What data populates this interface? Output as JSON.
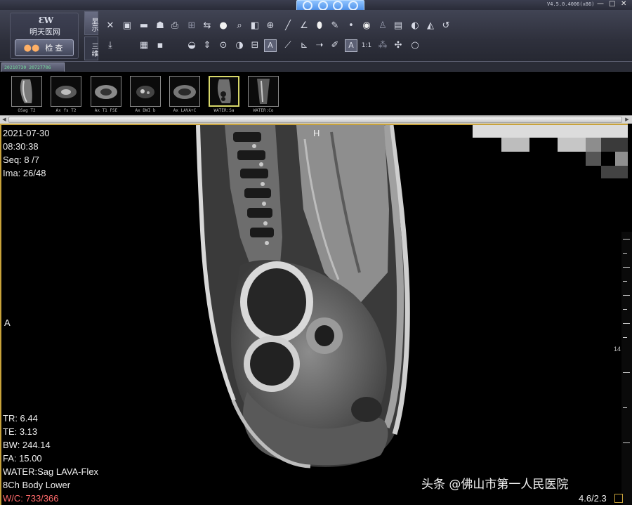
{
  "app": {
    "logo_text": "明天医网",
    "logo_button_label": "检查",
    "version": "V4.5.0.4006(x86)",
    "window_buttons": [
      "—",
      "□",
      "✕"
    ]
  },
  "toolbar": {
    "display_tab": "显示",
    "second_tab": "三维",
    "icons": [
      "measure-icon",
      "monitor-icon",
      "folder-icon",
      "patient-icon",
      "print-icon",
      "grid-layout-icon",
      "flip-icon",
      "sphere-icon",
      "magnifier-icon",
      "zoom-icon",
      "ruler-line-icon",
      "angle-icon",
      "ellipse-icon",
      "text-icon",
      "reset-icon"
    ],
    "text_tool_label": "A",
    "ratio_label": "1:1"
  },
  "study_tab": {
    "label": "20210730 20727706"
  },
  "series": [
    {
      "caption": "OSag T2",
      "selected": false
    },
    {
      "caption": "Ax fs T2",
      "selected": false
    },
    {
      "caption": "Ax T1 FSE",
      "selected": false
    },
    {
      "caption": "Ax DWI b",
      "selected": false
    },
    {
      "caption": "Ax LAVA+C",
      "selected": false
    },
    {
      "caption": "WATER:Sa",
      "selected": true
    },
    {
      "caption": "WATER:Co",
      "selected": false
    }
  ],
  "viewer": {
    "date": "2021-07-30",
    "time": "08:30:38",
    "seq": "Seq: 8 /7",
    "ima": "Ima: 26/48",
    "orient_top": "H",
    "orient_left": "A",
    "tr": "TR: 6.44",
    "te": "TE: 3.13",
    "bw": "BW: 244.14",
    "fa": "FA: 15.00",
    "series_desc": "WATER:Sag LAVA-Flex",
    "coil": "8Ch Body Lower",
    "wc": "W/C: 733/366",
    "zoom": "4.6/2.3",
    "ruler_label": "14",
    "accent_color": "#c8a23a"
  },
  "watermark": "头条 @佛山市第一人民医院"
}
